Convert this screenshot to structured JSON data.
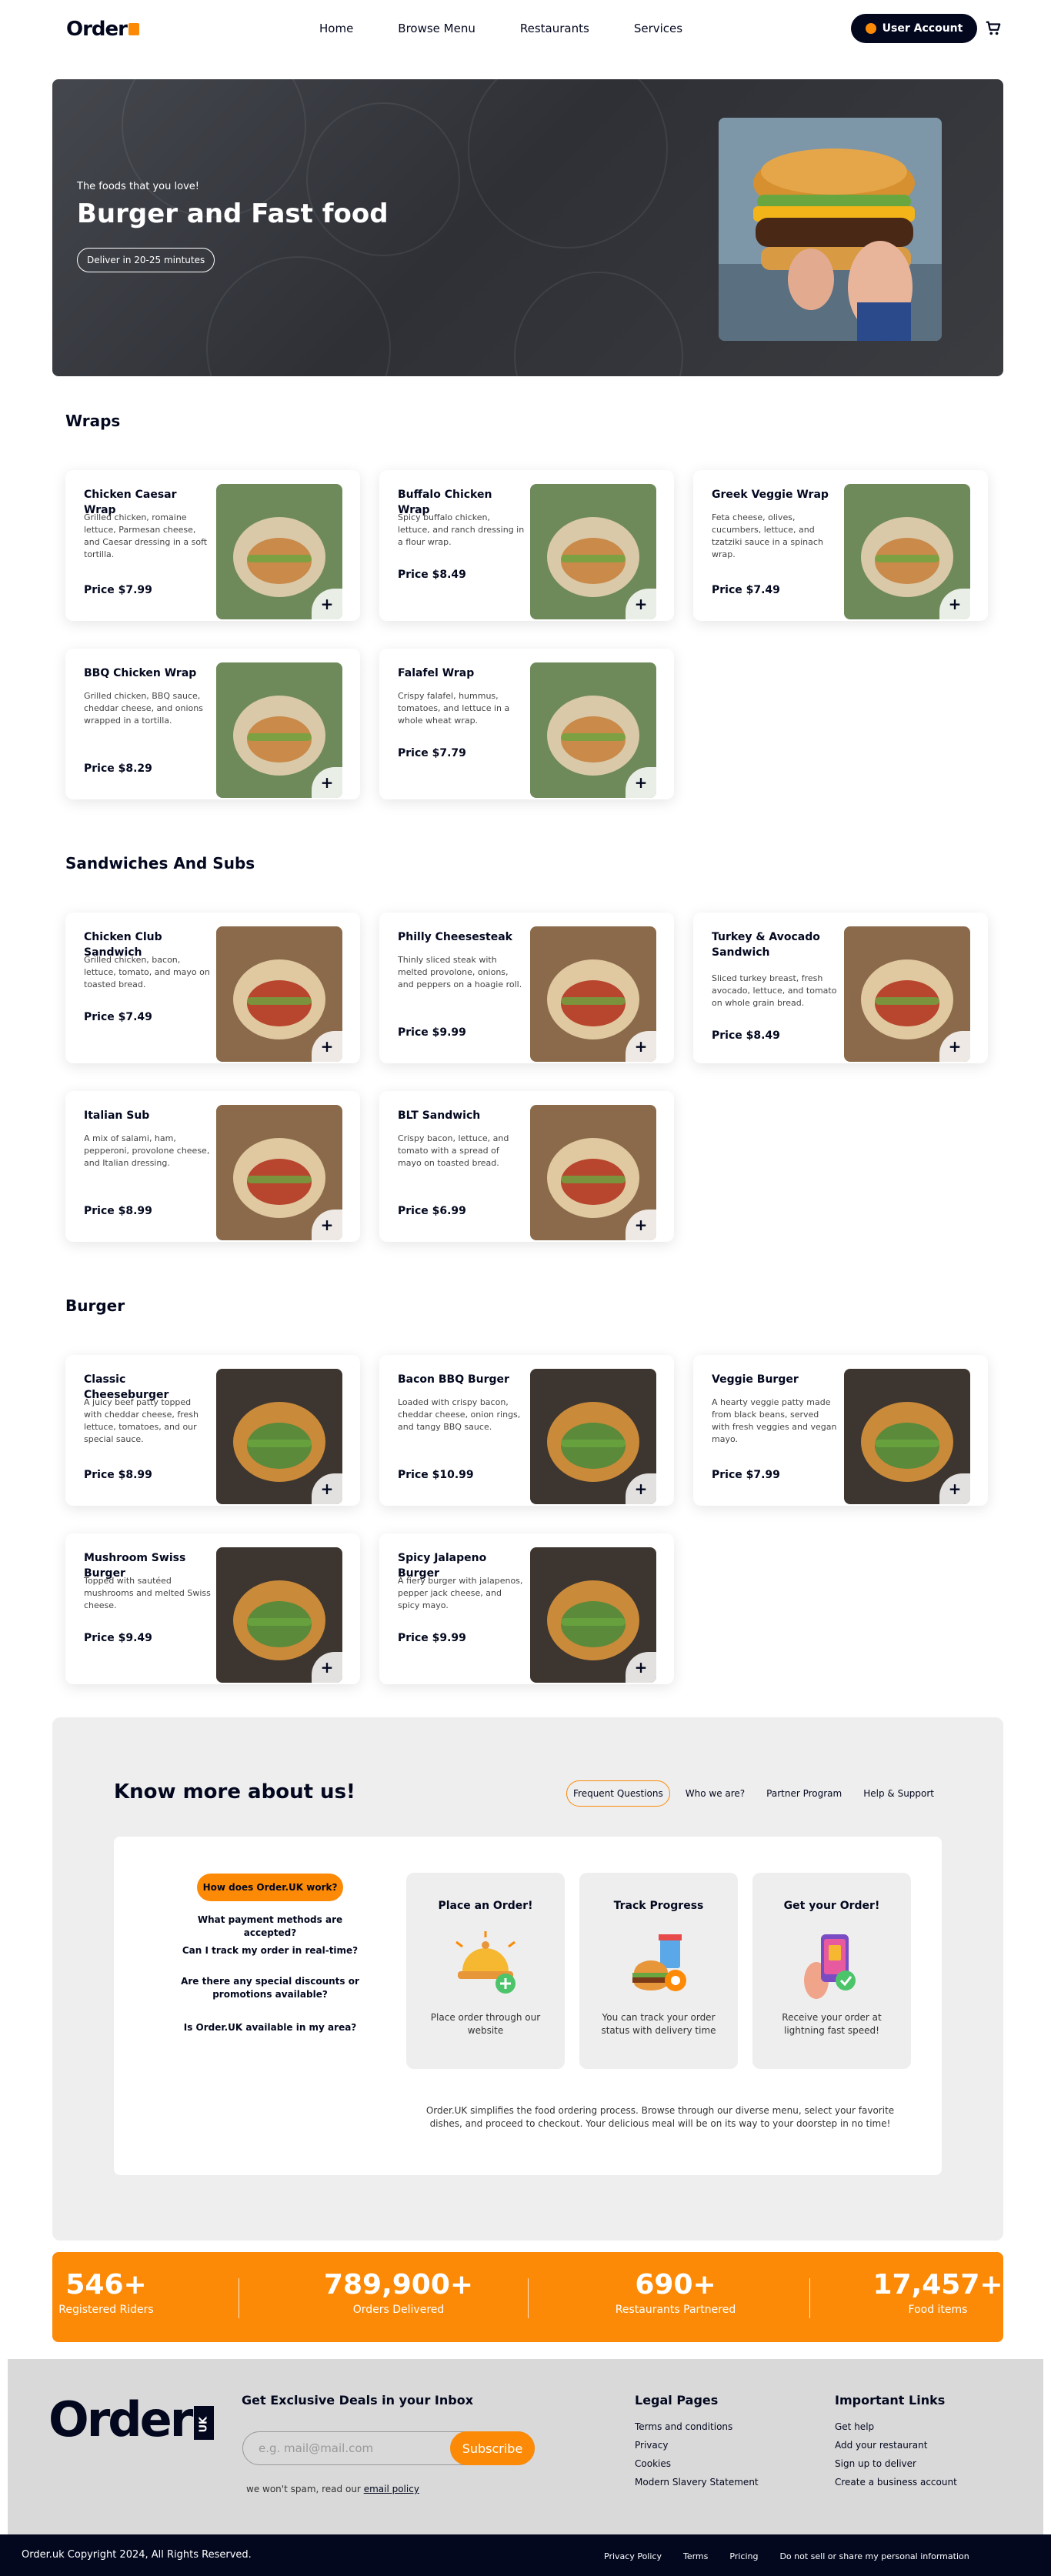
{
  "nav": {
    "logo": "Order",
    "links": [
      "Home",
      "Browse Menu",
      "Restaurants",
      "Services"
    ],
    "user_account": "User Account"
  },
  "hero": {
    "subtitle": "The foods that you love!",
    "title": "Burger and Fast food",
    "delivery_pill": "Deliver in 20-25 mintutes"
  },
  "sections": [
    {
      "title": "Wraps",
      "items": [
        {
          "name": "Chicken Caesar Wrap",
          "desc": "Grilled chicken, romaine lettuce, Parmesan cheese, and Caesar dressing in a soft tortilla.",
          "price": "Price $7.99"
        },
        {
          "name": "Buffalo Chicken Wrap",
          "desc": "Spicy buffalo chicken, lettuce, and ranch dressing in a flour wrap.",
          "price": "Price $8.49"
        },
        {
          "name": "Greek Veggie Wrap",
          "desc": "Feta cheese, olives, cucumbers, lettuce, and tzatziki sauce in a spinach wrap.",
          "price": "Price $7.49"
        },
        {
          "name": "BBQ Chicken Wrap",
          "desc": "Grilled chicken, BBQ sauce, cheddar cheese, and onions wrapped in a tortilla.",
          "price": "Price $8.29"
        },
        {
          "name": "Falafel Wrap",
          "desc": "Crispy falafel, hummus, tomatoes, and lettuce in a whole wheat wrap.",
          "price": "Price $7.79"
        }
      ]
    },
    {
      "title": "Sandwiches And Subs",
      "items": [
        {
          "name": "Chicken Club Sandwich",
          "desc": "Grilled chicken, bacon, lettuce, tomato, and mayo on toasted bread.",
          "price": "Price $7.49"
        },
        {
          "name": "Philly Cheesesteak",
          "desc": "Thinly sliced steak with melted provolone, onions, and peppers on a hoagie roll.",
          "price": "Price $9.99"
        },
        {
          "name": "Turkey & Avocado Sandwich",
          "desc": "Sliced turkey breast, fresh avocado, lettuce, and tomato on whole grain bread.",
          "price": "Price $8.49"
        },
        {
          "name": "Italian Sub",
          "desc": "A mix of salami, ham, pepperoni, provolone cheese, and Italian dressing.",
          "price": "Price $8.99"
        },
        {
          "name": "BLT Sandwich",
          "desc": "Crispy bacon, lettuce, and tomato with a spread of mayo on toasted bread.",
          "price": "Price $6.99"
        }
      ]
    },
    {
      "title": "Burger",
      "items": [
        {
          "name": "Classic Cheeseburger",
          "desc": "A juicy beef patty topped with cheddar cheese, fresh lettuce, tomatoes, and our special sauce.",
          "price": "Price $8.99"
        },
        {
          "name": "Bacon BBQ Burger",
          "desc": "Loaded with crispy bacon, cheddar cheese, onion rings, and tangy BBQ sauce.",
          "price": "Price $10.99"
        },
        {
          "name": "Veggie Burger",
          "desc": "A hearty veggie patty made from black beans, served with fresh veggies and vegan mayo.",
          "price": "Price $7.99"
        },
        {
          "name": "Mushroom Swiss Burger",
          "desc": "Topped with sautéed mushrooms and melted Swiss cheese.",
          "price": "Price $9.49"
        },
        {
          "name": "Spicy Jalapeno Burger",
          "desc": "A fiery burger with jalapenos, pepper jack cheese, and spicy mayo.",
          "price": "Price $9.99"
        }
      ]
    }
  ],
  "about": {
    "title": "Know more about us!",
    "tabs": [
      "Frequent Questions",
      "Who we are?",
      "Partner Program",
      "Help & Support"
    ],
    "faqs": [
      "How does Order.UK work?",
      "What payment methods are accepted?",
      "Can I track my order in real-time?",
      "Are there any special discounts or promotions available?",
      "Is Order.UK available in my area?"
    ],
    "steps": [
      {
        "title": "Place an Order!",
        "desc": "Place order through our website"
      },
      {
        "title": "Track Progress",
        "desc": "You can track your order status with delivery time"
      },
      {
        "title": "Get your Order!",
        "desc": "Receive your order at lightning fast speed!"
      }
    ],
    "paragraph": "Order.UK simplifies the food ordering process. Browse through our diverse menu, select your favorite dishes, and proceed to checkout. Your delicious meal will be on its way to your doorstep in no time!"
  },
  "stats": [
    {
      "num": "546+",
      "label": "Registered Riders"
    },
    {
      "num": "789,900+",
      "label": "Orders Delivered"
    },
    {
      "num": "690+",
      "label": "Restaurants Partnered"
    },
    {
      "num": "17,457+",
      "label": "Food items"
    }
  ],
  "footer": {
    "logo": "Order",
    "logo_badge": "UK",
    "deals_title": "Get Exclusive Deals in your Inbox",
    "email_placeholder": "e.g. mail@mail.com",
    "subscribe": "Subscribe",
    "spam_note": "we won't spam, read our",
    "email_policy": "email policy",
    "legal_title": "Legal Pages",
    "legal_links": [
      "Terms and conditions",
      "Privacy",
      "Cookies",
      "Modern Slavery Statement"
    ],
    "important_title": "Important Links",
    "important_links": [
      "Get help",
      "Add your restaurant",
      "Sign up to deliver",
      "Create a business account"
    ],
    "copyright": "Order.uk Copyright 2024, All Rights Reserved.",
    "bottom_links": [
      "Privacy Policy",
      "Terms",
      "Pricing",
      "Do not sell or share my personal information"
    ]
  },
  "colors": {
    "accent": "#FC8A06",
    "dark": "#03081F",
    "light_gray": "#EEEEEE"
  }
}
